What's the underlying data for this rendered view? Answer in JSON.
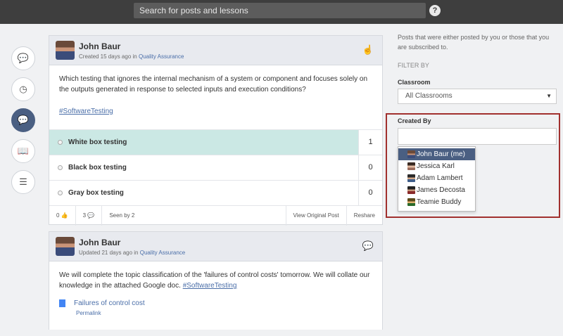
{
  "topbar": {
    "search_placeholder": "Search for posts and lessons",
    "help_label": "?"
  },
  "leftnav": [
    {
      "name": "nav-chat-icon",
      "glyph": "💬",
      "active": false
    },
    {
      "name": "nav-clock-icon",
      "glyph": "◷",
      "active": false
    },
    {
      "name": "nav-messages-icon",
      "glyph": "💬",
      "active": true
    },
    {
      "name": "nav-book-icon",
      "glyph": "📖",
      "active": false
    },
    {
      "name": "nav-list-icon",
      "glyph": "☰",
      "active": false
    }
  ],
  "post1": {
    "author": "John Baur",
    "meta_prefix": "Created 15 days ago in",
    "classroom": "Quality Assurance",
    "question": "Which testing that ignores the internal mechanism of a system or component and focuses solely on the outputs generated in response to selected inputs and execution conditions?",
    "tag": "#SoftwareTesting",
    "options": [
      {
        "label": "White box testing",
        "count": "1",
        "selected": true
      },
      {
        "label": "Black box testing",
        "count": "0",
        "selected": false
      },
      {
        "label": "Gray box testing",
        "count": "0",
        "selected": false
      }
    ],
    "footer": {
      "likes": "0",
      "comments": "3",
      "seen": "Seen by 2",
      "view": "View Original Post",
      "reshare": "Reshare"
    }
  },
  "post2": {
    "author": "John Baur",
    "meta_prefix": "Updated 21 days ago in",
    "classroom": "Quality Assurance",
    "text": "We will complete the topic classification of the 'failures of control costs' tomorrow. We will collate our knowledge in the attached Google doc.",
    "tag": "#SoftwareTesting",
    "attachment": "Failures of control cost",
    "permalink": "Permalink"
  },
  "filters": {
    "description": "Posts that were either posted by you or those that you are subscribed to.",
    "filter_by": "FILTER BY",
    "classroom_label": "Classroom",
    "classroom_value": "All Classrooms",
    "created_by_label": "Created By",
    "created_by_value": "",
    "users": [
      {
        "name": "John Baur (me)",
        "active": true
      },
      {
        "name": "Jessica Karl",
        "active": false
      },
      {
        "name": "Adam Lambert",
        "active": false
      },
      {
        "name": "James Decosta",
        "active": false
      },
      {
        "name": "Teamie Buddy",
        "active": false
      }
    ]
  },
  "colors": {
    "accent": "#4a5f82",
    "highlight": "#cbe8e4",
    "annotation": "#a1302e"
  }
}
